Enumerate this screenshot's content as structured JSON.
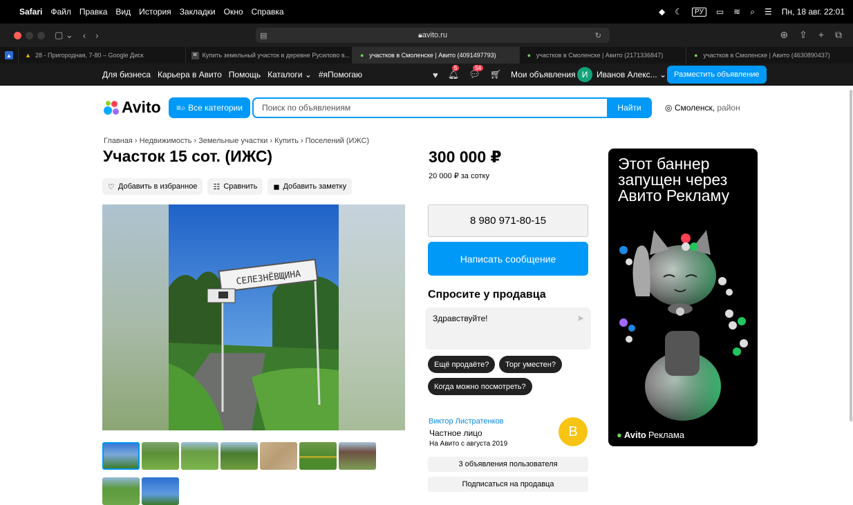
{
  "menubar": {
    "app": "Safari",
    "items": [
      "Файл",
      "Правка",
      "Вид",
      "История",
      "Закладки",
      "Окно",
      "Справка"
    ],
    "lang": "РУ",
    "clock": "Пн, 18 авг. 22:01"
  },
  "browser": {
    "url": "avito.ru",
    "tabs": [
      {
        "label": "28 - Пригородная, 7-80 – Google Диск"
      },
      {
        "label": "Купить земельный участок в деревне Русилово в..."
      },
      {
        "label": "участков в Смоленске | Авито (4091497793)"
      },
      {
        "label": "участков в Смоленске | Авито (2171336847)"
      },
      {
        "label": "участков в Смоленске | Авито (4630890437)"
      }
    ],
    "active_tab": 2
  },
  "topbar": {
    "links": [
      "Для бизнеса",
      "Карьера в Авито",
      "Помощь",
      "Каталоги ⌄",
      "#яПомогаю"
    ],
    "notif_badge": "5",
    "msg_badge": "54",
    "my_ads": "Мои объявления",
    "user_initial": "И",
    "user_name": "Иванов Алекс... ⌄",
    "post_button": "Разместить объявление"
  },
  "header": {
    "logo": "Avito",
    "categories_button": "Все категории",
    "search_placeholder": "Поиск по объявлениям",
    "find_button": "Найти",
    "city": "Смоленск,",
    "region": " район"
  },
  "listing": {
    "breadcrumb": "Главная › Недвижимость › Земельные участки › Купить › Поселений (ИЖС)",
    "title": "Участок 15 сот. (ИЖС)",
    "actions": {
      "favorite": "Добавить в избранное",
      "compare": "Сравнить",
      "note": "Добавить заметку"
    },
    "sign_text": "СЕЛЕЗНЁВЩИНА",
    "price": "300 000 ₽",
    "price_per": "20 000 ₽ за сотку",
    "phone": "8 980 971-80-15",
    "message_button": "Написать сообщение"
  },
  "ask": {
    "title": "Спросите у продавца",
    "draft": "Здравствуйте!",
    "chips": [
      "Ещё продаёте?",
      "Торг уместен?",
      "Когда можно посмотреть?"
    ]
  },
  "seller": {
    "name": "Виктор Листратенков",
    "type": "Частное лицо",
    "since": "На Авито с августа 2019",
    "initial": "В",
    "ads_button": "3 объявления пользователя",
    "subscribe_button": "Подписаться на продавца"
  },
  "banner": {
    "text": "Этот баннер запущен через Авито Рекламу",
    "brand": "Avito",
    "brand_suffix": "Реклама"
  },
  "colors": {
    "accent": "#0099f7",
    "topbar": "#1a1a1a",
    "seller_avatar": "#f8c413"
  }
}
